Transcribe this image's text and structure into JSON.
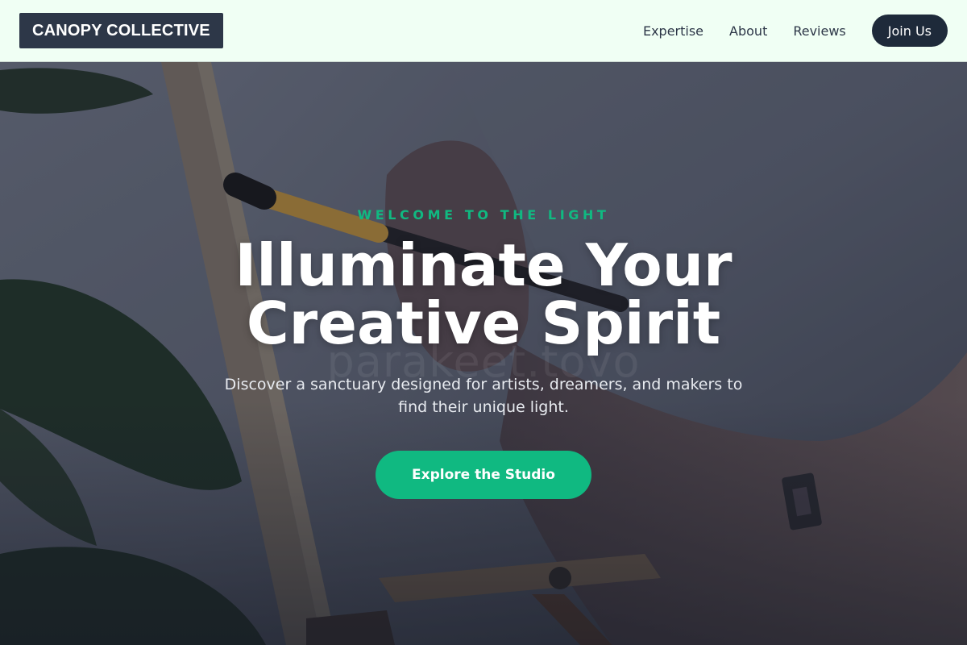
{
  "header": {
    "logo": "CANOPY COLLECTIVE",
    "nav": [
      {
        "label": "Expertise"
      },
      {
        "label": "About"
      },
      {
        "label": "Reviews"
      }
    ],
    "cta": "Join Us"
  },
  "hero": {
    "eyebrow": "WELCOME TO THE LIGHT",
    "headline_line1": "Illuminate Your",
    "headline_line2": "Creative Spirit",
    "subtext": "Discover a sanctuary designed for artists, dreamers, and makers to find their unique light.",
    "cta": "Explore the Studio",
    "watermark": "parakeet.tovo",
    "background_description_icon": "painter-brush-canvas-photo"
  },
  "colors": {
    "accent": "#10b981",
    "header_bg": "#f0fff4",
    "logo_bg": "#2d3748",
    "join_bg": "#1e2a3a"
  }
}
